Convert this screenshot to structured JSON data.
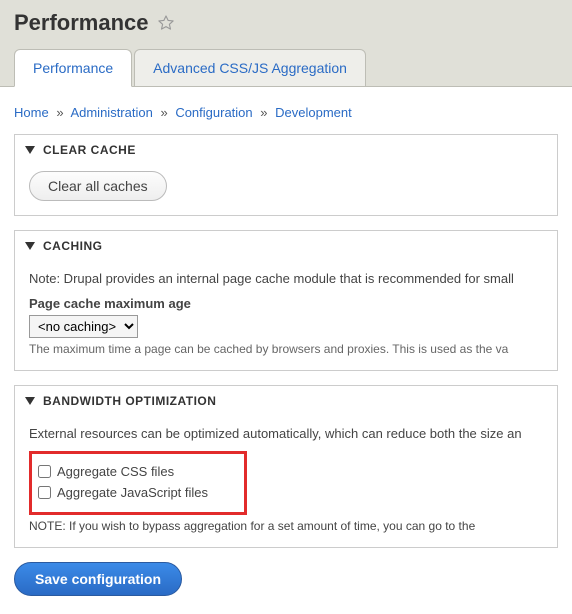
{
  "header": {
    "title": "Performance"
  },
  "tabs": {
    "primary": {
      "label": "Performance"
    },
    "secondary": {
      "label": "Advanced CSS/JS Aggregation"
    }
  },
  "breadcrumb": {
    "home": "Home",
    "admin": "Administration",
    "config": "Configuration",
    "dev": "Development"
  },
  "clear_cache": {
    "legend": "Clear cache",
    "button": "Clear all caches"
  },
  "caching": {
    "legend": "Caching",
    "note": "Note: Drupal provides an internal page cache module that is recommended for small",
    "max_age_label": "Page cache maximum age",
    "max_age_value": "<no caching>",
    "max_age_desc": "The maximum time a page can be cached by browsers and proxies. This is used as the va"
  },
  "bandwidth": {
    "legend": "Bandwidth optimization",
    "intro": "External resources can be optimized automatically, which can reduce both the size an",
    "aggregate_css": "Aggregate CSS files",
    "aggregate_js": "Aggregate JavaScript files",
    "bypass_note": "NOTE: If you wish to bypass aggregation for a set amount of time, you can go to the"
  },
  "actions": {
    "save": "Save configuration"
  }
}
